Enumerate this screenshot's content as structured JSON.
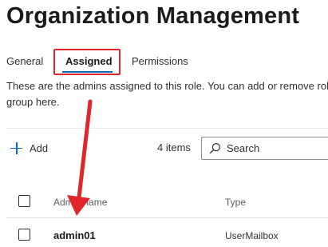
{
  "page": {
    "title": "Organization Management"
  },
  "tabs": [
    {
      "label": "General",
      "active": false
    },
    {
      "label": "Assigned",
      "active": true
    },
    {
      "label": "Permissions",
      "active": false
    }
  ],
  "description": "These are the admins assigned to this role. You can add or remove role group here.",
  "toolbar": {
    "add_label": "Add",
    "item_count": "4 items",
    "search_placeholder": "Search"
  },
  "table": {
    "columns": [
      "Admin name",
      "Type"
    ],
    "rows": [
      {
        "name": "admin01",
        "type": "UserMailbox"
      }
    ]
  },
  "colors": {
    "accent": "#0f6cbd",
    "annotation": "#e0262a"
  },
  "icons": {
    "add": "plus-icon",
    "search": "search-icon"
  }
}
